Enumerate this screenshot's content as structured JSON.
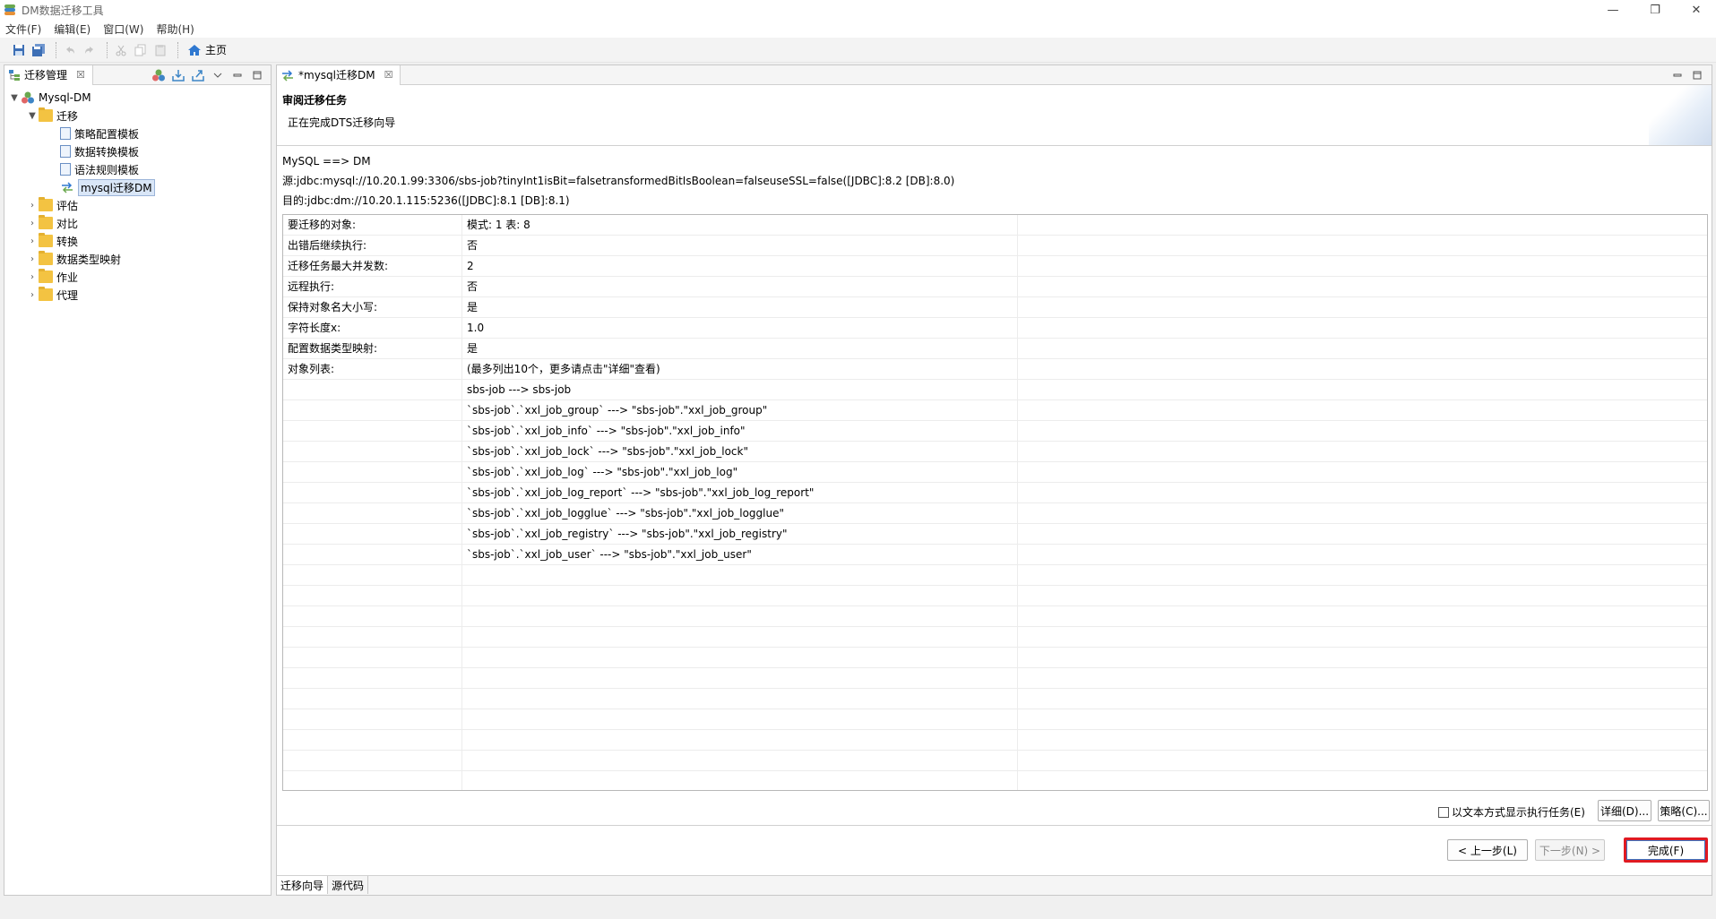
{
  "window": {
    "title": "DM数据迁移工具",
    "min": "—",
    "restore": "❐",
    "close": "✕"
  },
  "menu": [
    "文件(F)",
    "编辑(E)",
    "窗口(W)",
    "帮助(H)"
  ],
  "toolbar": {
    "home_label": "主页"
  },
  "left_panel": {
    "tab_label": "迁移管理",
    "tab_close": "☒",
    "tree": {
      "root": "Mysql-DM",
      "migrate": "迁移",
      "migrate_children": [
        "策略配置模板",
        "数据转换模板",
        "语法规则模板",
        "mysql迁移DM"
      ],
      "others": [
        "评估",
        "对比",
        "转换",
        "数据类型映射",
        "作业",
        "代理"
      ]
    }
  },
  "right_panel": {
    "tab_label": "*mysql迁移DM",
    "tab_close": "☒",
    "header_title": "审阅迁移任务",
    "header_subtitle": "正在完成DTS迁移向导",
    "info": [
      "MySQL ==> DM",
      "源:jdbc:mysql://10.20.1.99:3306/sbs-job?tinyInt1isBit=falsetransformedBitIsBoolean=falseuseSSL=false([JDBC]:8.2 [DB]:8.0)",
      "目的:jdbc:dm://10.20.1.115:5236([JDBC]:8.1 [DB]:8.1)"
    ],
    "rows": [
      {
        "k": "要迁移的对象:",
        "v": "模式: 1 表: 8"
      },
      {
        "k": "出错后继续执行:",
        "v": "否"
      },
      {
        "k": "迁移任务最大并发数:",
        "v": "2"
      },
      {
        "k": "远程执行:",
        "v": "否"
      },
      {
        "k": "保持对象名大小写:",
        "v": "是"
      },
      {
        "k": "字符长度x:",
        "v": "1.0"
      },
      {
        "k": "配置数据类型映射:",
        "v": "是"
      },
      {
        "k": "对象列表:",
        "v": "(最多列出10个，更多请点击\"详细\"查看)"
      },
      {
        "k": "",
        "v": "sbs-job ---> sbs-job"
      },
      {
        "k": "",
        "v": "`sbs-job`.`xxl_job_group` ---> \"sbs-job\".\"xxl_job_group\""
      },
      {
        "k": "",
        "v": "`sbs-job`.`xxl_job_info` ---> \"sbs-job\".\"xxl_job_info\""
      },
      {
        "k": "",
        "v": "`sbs-job`.`xxl_job_lock` ---> \"sbs-job\".\"xxl_job_lock\""
      },
      {
        "k": "",
        "v": "`sbs-job`.`xxl_job_log` ---> \"sbs-job\".\"xxl_job_log\""
      },
      {
        "k": "",
        "v": "`sbs-job`.`xxl_job_log_report` ---> \"sbs-job\".\"xxl_job_log_report\""
      },
      {
        "k": "",
        "v": "`sbs-job`.`xxl_job_logglue` ---> \"sbs-job\".\"xxl_job_logglue\""
      },
      {
        "k": "",
        "v": "`sbs-job`.`xxl_job_registry` ---> \"sbs-job\".\"xxl_job_registry\""
      },
      {
        "k": "",
        "v": "`sbs-job`.`xxl_job_user` ---> \"sbs-job\".\"xxl_job_user\""
      }
    ],
    "text_mode_label": "以文本方式显示执行任务(E)",
    "detail_button": "详细(D)...",
    "strategy_button": "策略(C)...",
    "prev_button": "< 上一步(L)",
    "next_button": "下一步(N) >",
    "finish_button": "完成(F)",
    "bottom_tabs": [
      "迁移向导",
      "源代码"
    ]
  },
  "colors": {
    "highlight_red": "#e01a22",
    "selection": "#d9e6f7"
  }
}
